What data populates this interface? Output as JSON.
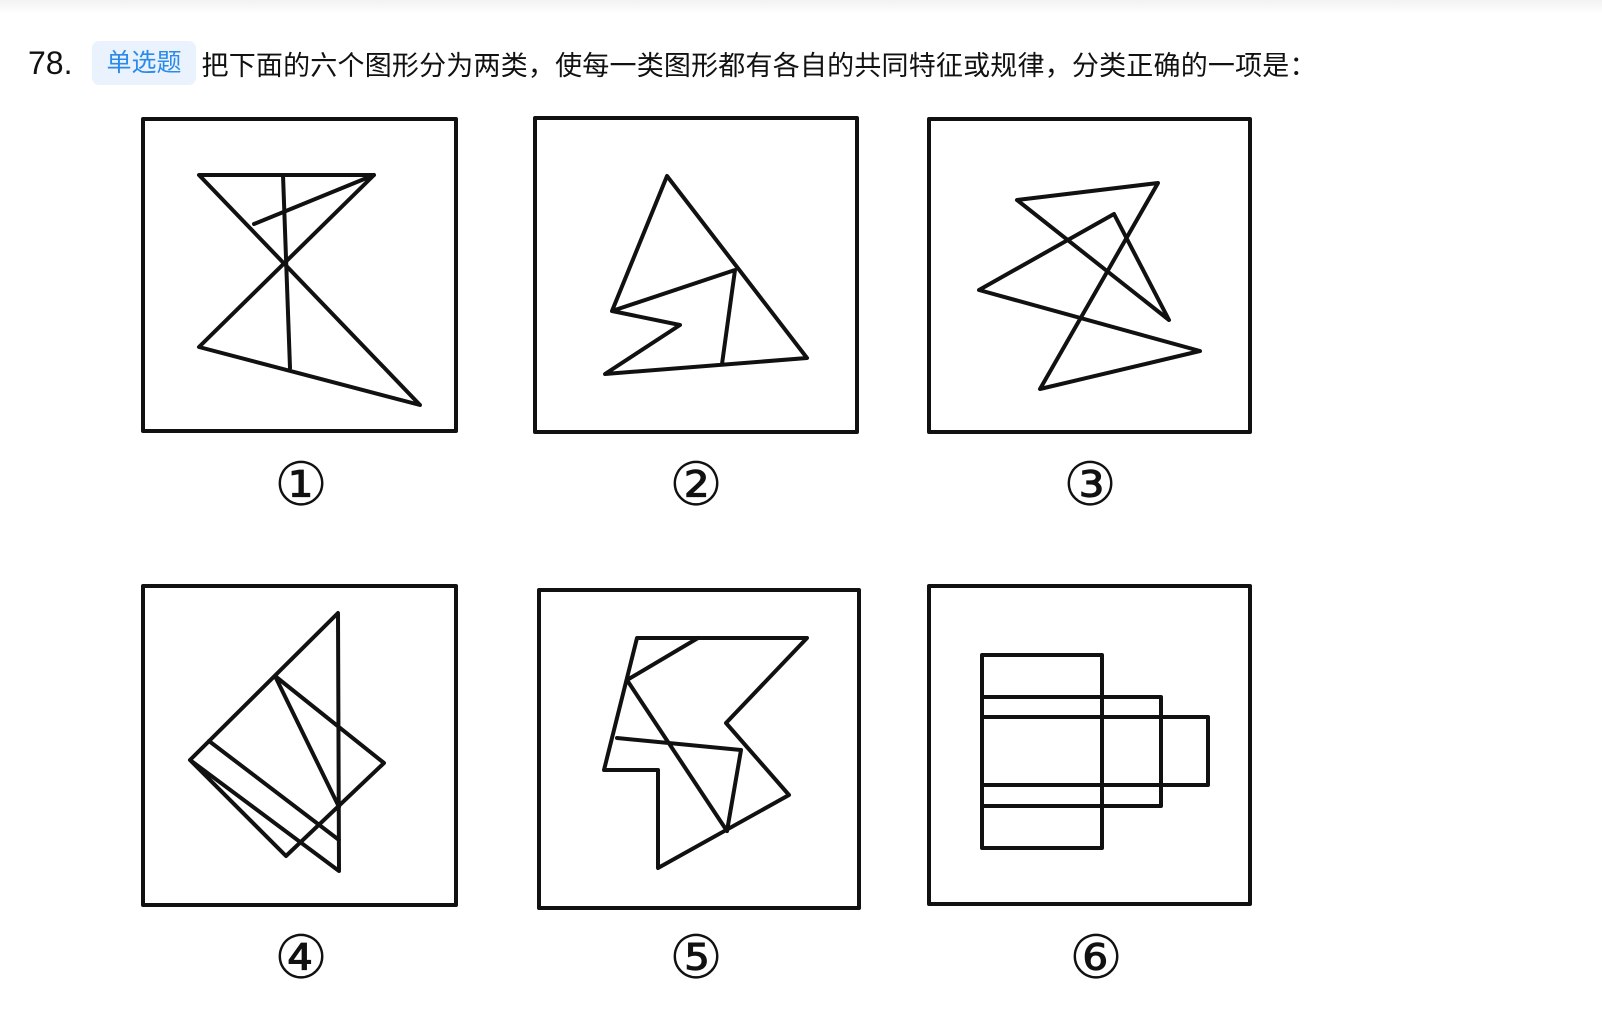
{
  "question": {
    "number": "78.",
    "type_badge": "单选题",
    "text": "把下面的六个图形分为两类，使每一类图形都有各自的共同特征或规律，分类正确的一项是："
  },
  "figures": [
    {
      "label": "①"
    },
    {
      "label": "②"
    },
    {
      "label": "③"
    },
    {
      "label": "④"
    },
    {
      "label": "⑤"
    },
    {
      "label": "⑥"
    }
  ],
  "colors": {
    "badge_bg": "#eaf3fd",
    "badge_text": "#2c8ae8",
    "line": "#111111"
  }
}
